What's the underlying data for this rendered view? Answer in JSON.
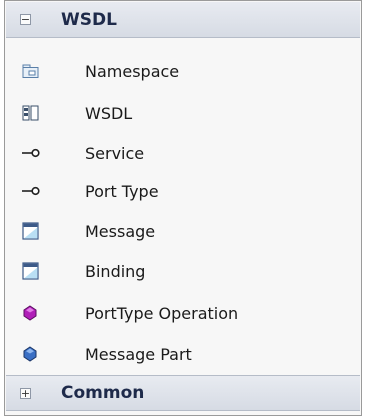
{
  "groups": {
    "wsdl": {
      "title": "WSDL",
      "toggle": "−",
      "items": [
        {
          "label": "Namespace",
          "icon": "namespace-icon"
        },
        {
          "label": "WSDL",
          "icon": "wsdl-icon"
        },
        {
          "label": "Service",
          "icon": "service-icon"
        },
        {
          "label": "Port Type",
          "icon": "port-type-icon"
        },
        {
          "label": "Message",
          "icon": "message-icon"
        },
        {
          "label": "Binding",
          "icon": "binding-icon"
        },
        {
          "label": "PortType Operation",
          "icon": "porttype-operation-icon"
        },
        {
          "label": "Message Part",
          "icon": "message-part-icon"
        }
      ]
    },
    "common": {
      "title": "Common",
      "toggle": "+"
    }
  },
  "colors": {
    "header_bg": "#dde1e8",
    "operation_purple": "#b01fb8",
    "message_part_blue": "#3a6fc4"
  }
}
